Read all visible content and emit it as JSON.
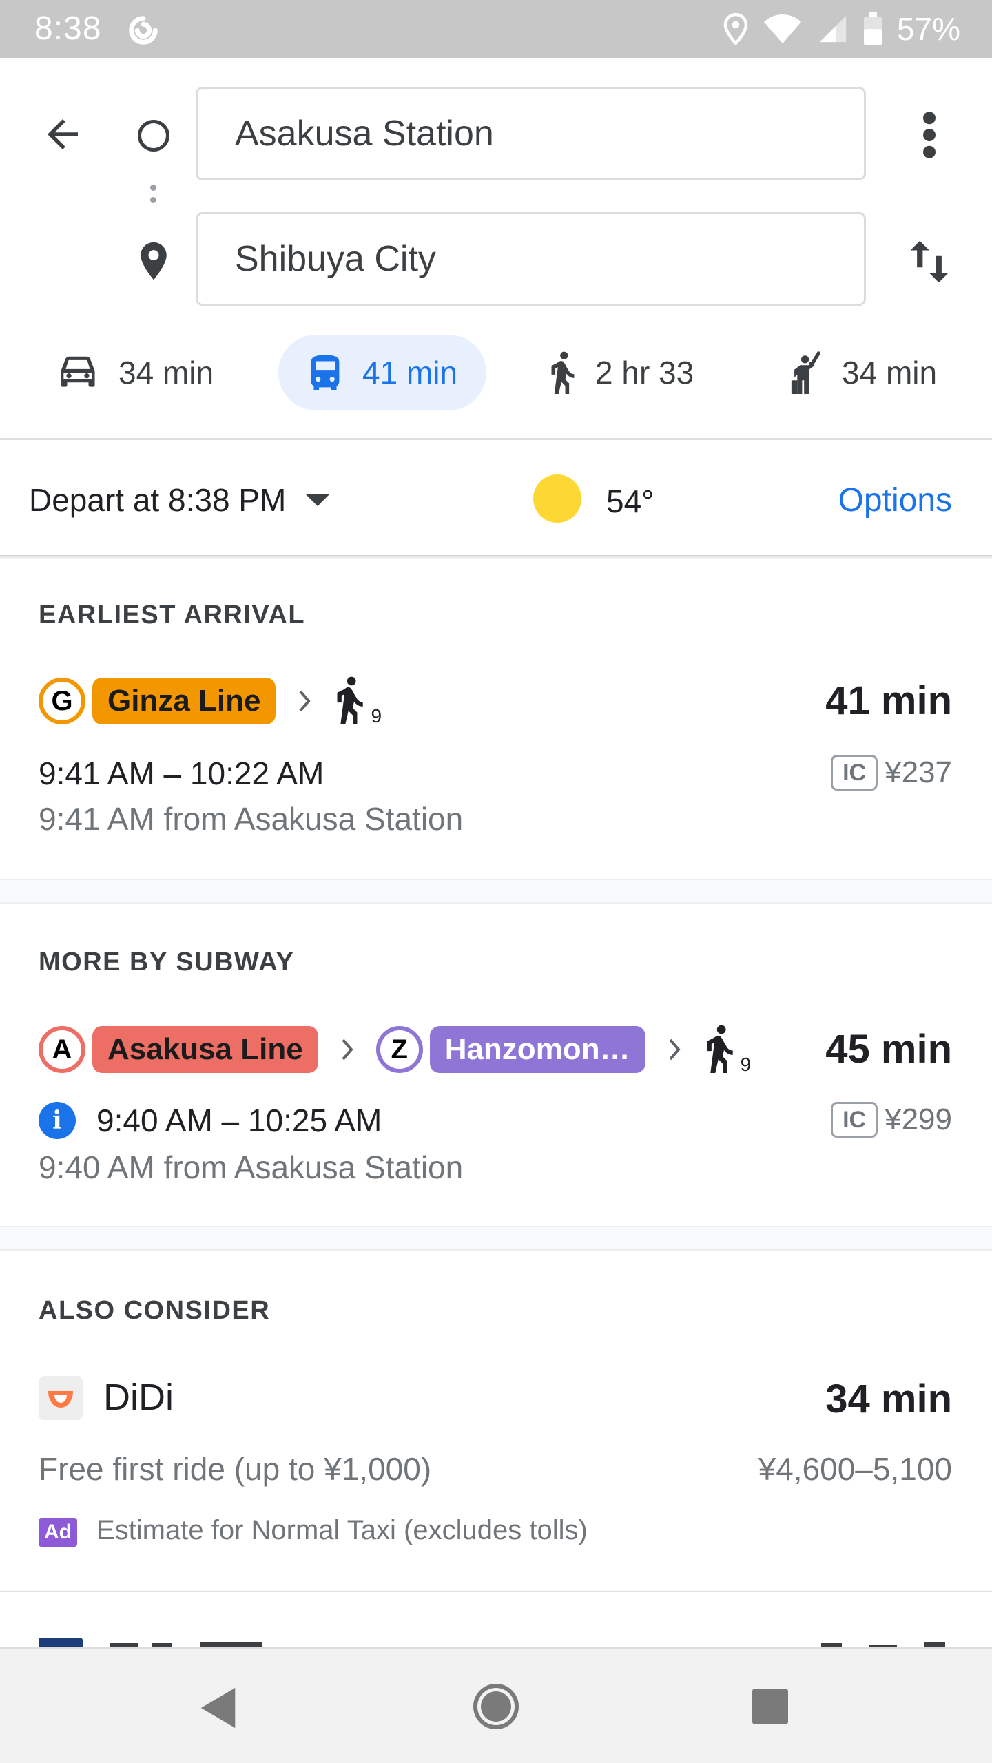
{
  "status_bar": {
    "time": "8:38",
    "battery": "57%"
  },
  "search": {
    "origin": "Asakusa Station",
    "destination": "Shibuya City"
  },
  "modes": [
    {
      "icon": "car-icon",
      "label": "34 min"
    },
    {
      "icon": "transit-icon",
      "label": "41 min",
      "selected": true
    },
    {
      "icon": "walk-icon",
      "label": "2 hr 33"
    },
    {
      "icon": "ride-hailing-icon",
      "label": "34 min"
    }
  ],
  "trip": {
    "depart": "Depart at 8:38 PM",
    "weather_temp": "54°",
    "options": "Options"
  },
  "earliest": {
    "heading": "EARLIEST ARRIVAL",
    "line_badge": "G",
    "line_name": "Ginza Line",
    "walk_minutes": "9",
    "duration": "41 min",
    "times": "9:41 AM – 10:22 AM",
    "fare_badge": "IC",
    "fare": "¥237",
    "from": "9:41 AM from Asakusa Station"
  },
  "subway": {
    "heading": "MORE BY SUBWAY",
    "line1_badge": "A",
    "line1_name": "Asakusa Line",
    "line2_badge": "Z",
    "line2_name": "Hanzomon…",
    "walk_minutes": "9",
    "duration": "45 min",
    "info": "i",
    "times": "9:40 AM – 10:25 AM",
    "fare_badge": "IC",
    "fare": "¥299",
    "from": "9:40 AM from Asakusa Station"
  },
  "also": {
    "heading": "ALSO CONSIDER",
    "provider": "DiDi",
    "duration": "34 min",
    "promo": "Free first ride (up to ¥1,000)",
    "price": "¥4,600–5,100",
    "ad": "Ad",
    "estimate": "Estimate for Normal Taxi (excludes tolls)"
  },
  "colors": {
    "accent": "#1a73e8",
    "ginza": "#f39700",
    "asakusa": "#ec6e65",
    "hanzomon": "#8f76d6"
  }
}
